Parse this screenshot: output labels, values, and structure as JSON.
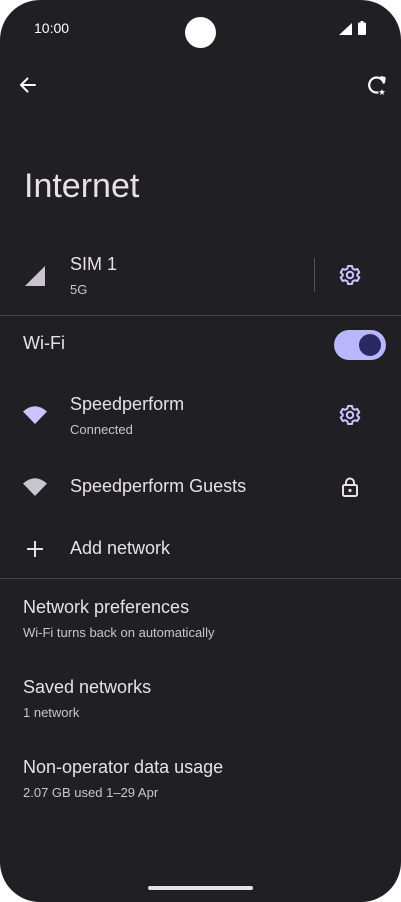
{
  "status_bar": {
    "time": "10:00"
  },
  "header": {
    "title": "Internet"
  },
  "sim": {
    "name": "SIM 1",
    "type": "5G"
  },
  "wifi": {
    "label": "Wi-Fi",
    "enabled": true,
    "networks": [
      {
        "name": "Speedperform",
        "status": "Connected"
      },
      {
        "name": "Speedperform Guests"
      }
    ],
    "add_label": "Add network"
  },
  "settings": [
    {
      "title": "Network preferences",
      "subtitle": "Wi-Fi turns back on automatically"
    },
    {
      "title": "Saved networks",
      "subtitle": "1 network"
    },
    {
      "title": "Non-operator data usage",
      "subtitle": "2.07 GB used 1–29 Apr"
    }
  ],
  "colors": {
    "background": "#202024",
    "accent": "#b9b6fb",
    "accent_dark": "#2a2a63"
  }
}
